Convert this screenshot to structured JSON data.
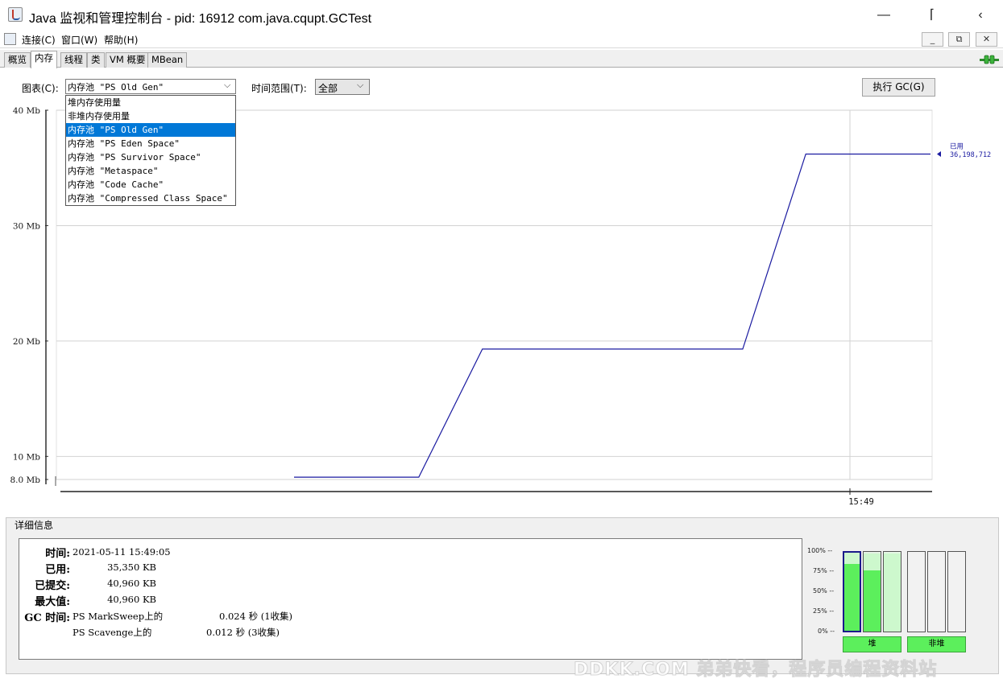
{
  "window": {
    "title": "Java 监视和管理控制台 - pid: 16912 com.java.cqupt.GCTest",
    "minimize": "—",
    "maximize": "⌈",
    "close": "‹"
  },
  "menubar": {
    "items": [
      "连接(C)",
      "窗口(W)",
      "帮助(H)"
    ],
    "inner_minimize": "_",
    "inner_restore": "⧉",
    "inner_close": "✕"
  },
  "tabs": [
    "概览",
    "内存",
    "线程",
    "类",
    "VM 概要",
    "MBean"
  ],
  "active_tab": "内存",
  "controls": {
    "chart_label": "图表(C):",
    "chart_value": "内存池 \"PS Old Gen\"",
    "range_label": "时间范围(T):",
    "range_value": "全部",
    "gc_button": "执行 GC(G)"
  },
  "dropdown": {
    "options": [
      "堆内存使用量",
      "非堆内存使用量",
      "内存池 \"PS Old Gen\"",
      "内存池 \"PS Eden Space\"",
      "内存池 \"PS Survivor Space\"",
      "内存池 \"Metaspace\"",
      "内存池 \"Code Cache\"",
      "内存池 \"Compressed Class Space\""
    ],
    "selected_index": 2
  },
  "chart_data": {
    "type": "line",
    "y_ticks": [
      "40 Mb",
      "30 Mb",
      "20 Mb",
      "10 Mb",
      "8.0 Mb"
    ],
    "y_tick_values": [
      40,
      30,
      20,
      10,
      8
    ],
    "ylim": [
      8,
      40
    ],
    "x_ticks": [
      "15:49"
    ],
    "series": [
      {
        "name": "已用",
        "color": "#1a1aa0",
        "points": [
          [
            0.0,
            8.2
          ],
          [
            0.196,
            8.2
          ],
          [
            0.296,
            19.3
          ],
          [
            0.705,
            19.3
          ],
          [
            0.804,
            36.2
          ],
          [
            1.0,
            36.2
          ]
        ]
      }
    ],
    "current_label": "已用",
    "current_value": "36,198,712",
    "grid": true
  },
  "details": {
    "title": "详细信息",
    "rows": [
      {
        "label": "时间:",
        "value": "2021-05-11 15:49:05"
      },
      {
        "label": "已用:",
        "value": "35,350 KB"
      },
      {
        "label": "已提交:",
        "value": "40,960 KB"
      },
      {
        "label": "最大值:",
        "value": "40,960 KB"
      }
    ],
    "gc_label": "GC 时间:",
    "gc_rows": [
      {
        "name": "PS MarkSweep上的",
        "time": "0.024 秒 (1收集)"
      },
      {
        "name": "PS Scavenge上的",
        "time": "0.012 秒 (3收集)"
      }
    ]
  },
  "mini_bars": {
    "pct_labels": [
      "100% --",
      "75% --",
      "50% --",
      "25% --",
      "0% --"
    ],
    "heap_label": "堆",
    "nonheap_label": "非堆",
    "heap_bars": [
      {
        "used": 0.86,
        "committed": 1.0
      },
      {
        "used": 0.78,
        "committed": 1.0
      },
      {
        "used": 0.0,
        "committed": 1.0
      }
    ],
    "nonheap_bars": [
      {
        "used": 0.0,
        "committed": 0.0
      },
      {
        "used": 0.0,
        "committed": 0.0
      },
      {
        "used": 0.0,
        "committed": 0.0
      }
    ]
  },
  "watermark": "DDKK.COM 弟弟快看，程序员编程资料站"
}
